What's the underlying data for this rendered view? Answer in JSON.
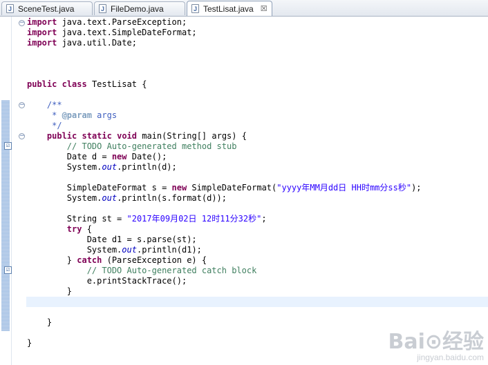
{
  "tabs": [
    {
      "label": "SceneTest.java",
      "icon": "java-file-icon"
    },
    {
      "label": "FileDemo.java",
      "icon": "java-file-icon"
    },
    {
      "label": "TestLisat.java",
      "icon": "java-file-icon",
      "active": true,
      "close": "☒"
    }
  ],
  "code": [
    {
      "t": "import java.text.ParseException;",
      "s": [
        [
          "kw",
          "import"
        ],
        [
          "",
          "  java.text.ParseException;"
        ]
      ]
    },
    {
      "t": "import java.text.SimpleDateFormat;",
      "s": [
        [
          "kw",
          "import"
        ],
        [
          "",
          "  java.text.SimpleDateFormat;"
        ]
      ]
    },
    {
      "t": "import java.util.Date;",
      "s": [
        [
          "kw",
          "import"
        ],
        [
          "",
          "  java.util.Date;"
        ]
      ]
    },
    {
      "t": "",
      "s": []
    },
    {
      "t": "",
      "s": []
    },
    {
      "t": "",
      "s": []
    },
    {
      "t": "public class TestLisat {",
      "s": [
        [
          "kw",
          "public"
        ],
        [
          "",
          " "
        ],
        [
          "kw",
          "class"
        ],
        [
          "",
          " TestLisat {"
        ]
      ]
    },
    {
      "t": "",
      "s": []
    },
    {
      "t": "    /**",
      "s": [
        [
          "jd",
          "    /**"
        ]
      ]
    },
    {
      "t": "     * @param args",
      "s": [
        [
          "jd",
          "     * "
        ],
        [
          "jdt",
          "@param"
        ],
        [
          "jd",
          " args"
        ]
      ]
    },
    {
      "t": "     */",
      "s": [
        [
          "jd",
          "     */"
        ]
      ]
    },
    {
      "t": "    public static void main(String[] args) {",
      "s": [
        [
          "",
          "    "
        ],
        [
          "kw",
          "public"
        ],
        [
          "",
          " "
        ],
        [
          "kw",
          "static"
        ],
        [
          "",
          " "
        ],
        [
          "kw",
          "void"
        ],
        [
          "",
          " main(String[] args) {"
        ]
      ]
    },
    {
      "t": "        // TODO Auto-generated method stub",
      "s": [
        [
          "cm",
          "        // TODO Auto-generated method stub"
        ]
      ]
    },
    {
      "t": "        Date d = new Date();",
      "s": [
        [
          "",
          "        Date d = "
        ],
        [
          "kw",
          "new"
        ],
        [
          "",
          " Date();"
        ]
      ]
    },
    {
      "t": "        System.out.println(d);",
      "s": [
        [
          "",
          "        System."
        ],
        [
          "st",
          "out"
        ],
        [
          "",
          ".println(d);"
        ]
      ]
    },
    {
      "t": "",
      "s": []
    },
    {
      "t": "        SimpleDateFormat s = new SimpleDateFormat(\"yyyy年MM月dd日 HH时mm分ss秒\");",
      "s": [
        [
          "",
          "        SimpleDateFormat s = "
        ],
        [
          "kw",
          "new"
        ],
        [
          "",
          " SimpleDateFormat("
        ],
        [
          "str",
          "\"yyyy年MM月dd日 HH时mm分ss秒\""
        ],
        [
          "",
          ");"
        ]
      ]
    },
    {
      "t": "        System.out.println(s.format(d));",
      "s": [
        [
          "",
          "        System."
        ],
        [
          "st",
          "out"
        ],
        [
          "",
          ".println(s.format(d));"
        ]
      ]
    },
    {
      "t": "",
      "s": []
    },
    {
      "t": "        String st = \"2017年09月02日 12时11分32秒\";",
      "s": [
        [
          "",
          "        String st = "
        ],
        [
          "str",
          "\"2017年09月02日 12时11分32秒\""
        ],
        [
          "",
          ";"
        ]
      ]
    },
    {
      "t": "        try {",
      "s": [
        [
          "",
          "        "
        ],
        [
          "kw",
          "try"
        ],
        [
          "",
          " {"
        ]
      ]
    },
    {
      "t": "            Date d1 = s.parse(st);",
      "s": [
        [
          "",
          "            Date d1 = s.parse(st);"
        ]
      ]
    },
    {
      "t": "            System.out.println(d1);",
      "s": [
        [
          "",
          "            System."
        ],
        [
          "st",
          "out"
        ],
        [
          "",
          ".println(d1);"
        ]
      ]
    },
    {
      "t": "        } catch (ParseException e) {",
      "s": [
        [
          "",
          "        } "
        ],
        [
          "kw",
          "catch"
        ],
        [
          "",
          " (ParseException e) {"
        ]
      ]
    },
    {
      "t": "            // TODO Auto-generated catch block",
      "s": [
        [
          "cm",
          "            // TODO Auto-generated catch block"
        ]
      ]
    },
    {
      "t": "            e.printStackTrace();",
      "s": [
        [
          "",
          "            e.printStackTrace();"
        ]
      ]
    },
    {
      "t": "        }",
      "s": [
        [
          "",
          "        }"
        ]
      ]
    },
    {
      "t": "",
      "s": []
    },
    {
      "t": "",
      "s": []
    },
    {
      "t": "    }",
      "s": [
        [
          "",
          "    }"
        ]
      ]
    },
    {
      "t": "",
      "s": []
    },
    {
      "t": "}",
      "s": [
        [
          "",
          "}"
        ]
      ]
    }
  ],
  "gutter": {
    "fold_markers": [
      "⊖",
      "⊖",
      "⊖"
    ],
    "task_markers": [
      "☑",
      "☑"
    ]
  },
  "watermark": {
    "logo": "Bai⊙经验",
    "url": "jingyan.baidu.com"
  },
  "colors": {
    "keyword": "#7f0055",
    "comment": "#3f7f5f",
    "javadoc": "#3f5fbf",
    "string": "#2a00ff",
    "static_field": "#0000c0",
    "current_line": "#e8f2fe"
  }
}
